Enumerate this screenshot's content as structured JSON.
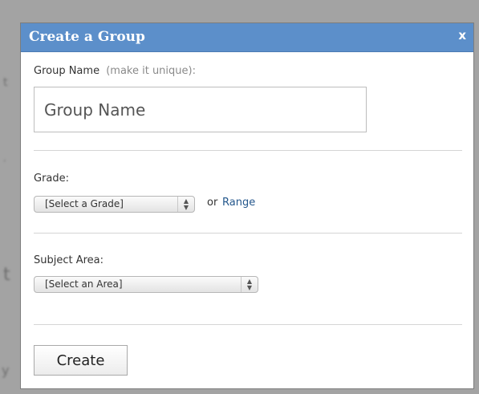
{
  "dialog": {
    "title": "Create a Group",
    "close_label": "x"
  },
  "group_name": {
    "label": "Group Name",
    "hint": "(make it unique):",
    "placeholder": "Group Name"
  },
  "grade": {
    "label": "Grade:",
    "select_value": "[Select a Grade]",
    "or_text": "or",
    "range_link": "Range"
  },
  "subject": {
    "label": "Subject Area:",
    "select_value": "[Select an Area]"
  },
  "actions": {
    "create_label": "Create"
  },
  "icons": {
    "select_arrows": "up-down-arrows-icon"
  },
  "colors": {
    "titlebar": "#5c8fca",
    "link": "#24578c"
  }
}
